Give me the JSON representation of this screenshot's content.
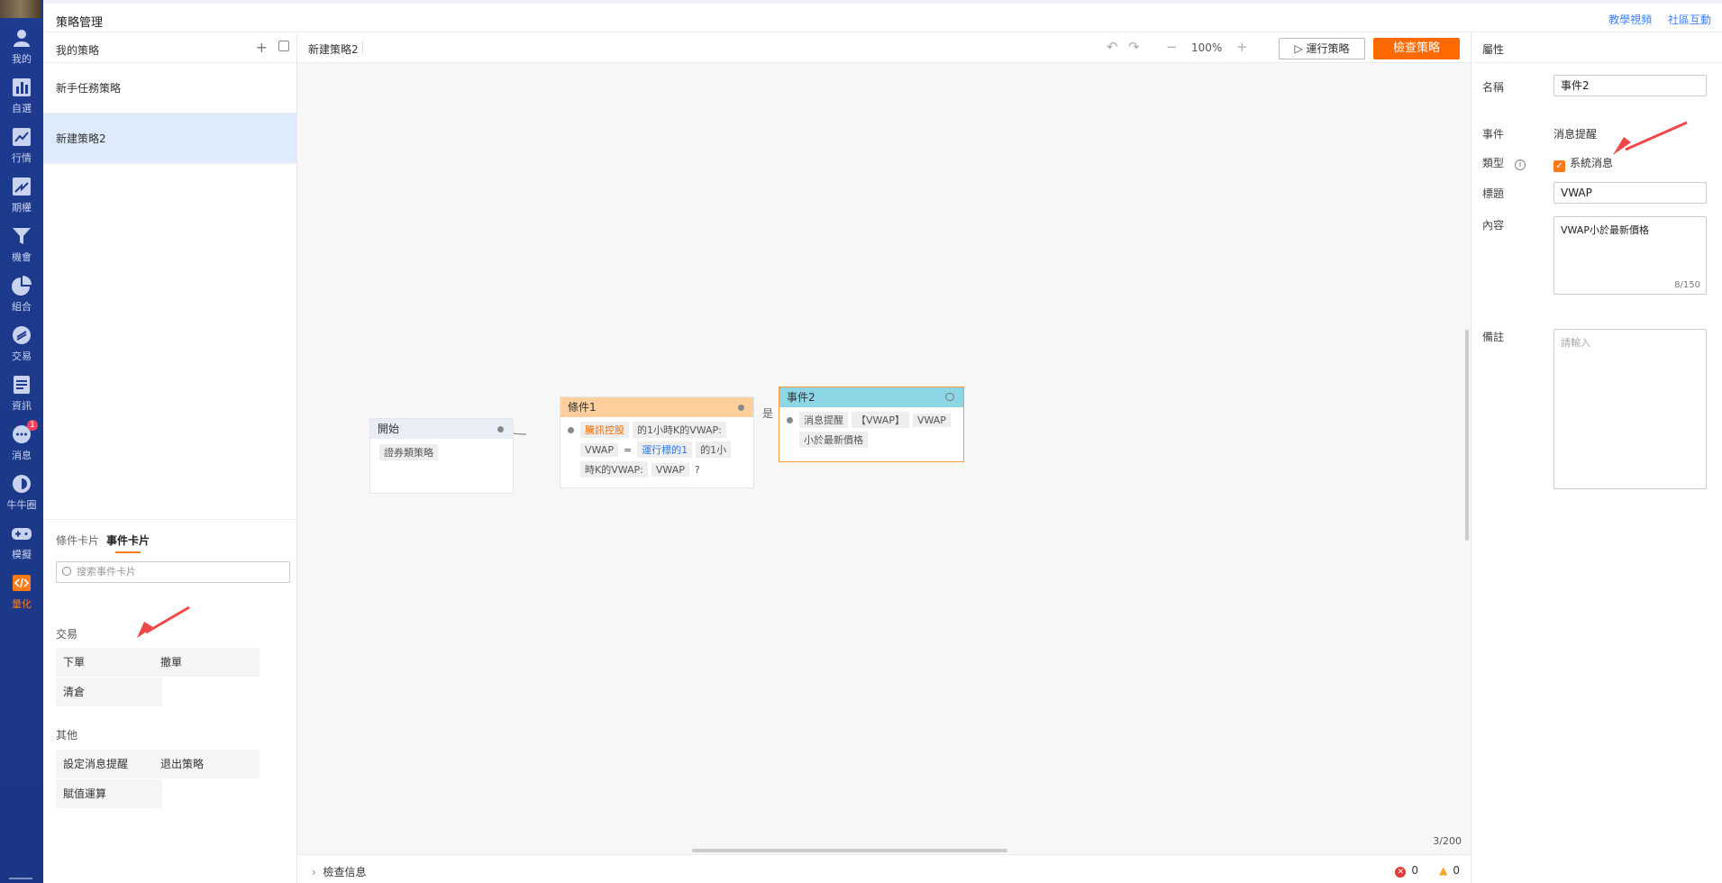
{
  "nav": [
    {
      "label": "我的",
      "icon": "user-icon"
    },
    {
      "label": "自選",
      "icon": "bar-chart-icon"
    },
    {
      "label": "行情",
      "icon": "trend-icon"
    },
    {
      "label": "期權",
      "icon": "options-icon"
    },
    {
      "label": "機會",
      "icon": "funnel-icon"
    },
    {
      "label": "組合",
      "icon": "pie-icon"
    },
    {
      "label": "交易",
      "icon": "exchange-icon"
    },
    {
      "label": "資訊",
      "icon": "news-icon"
    },
    {
      "label": "消息",
      "icon": "chat-icon",
      "badge": "1"
    },
    {
      "label": "牛牛圈",
      "icon": "circle-icon"
    },
    {
      "label": "模擬",
      "icon": "gamepad-icon"
    },
    {
      "label": "量化",
      "icon": "code-icon",
      "active": true
    }
  ],
  "topbar": {
    "title": "策略管理",
    "links": [
      "教學視頻",
      "社區互動"
    ]
  },
  "left": {
    "header": "我的策略",
    "strategies": [
      {
        "name": "新手任務策略"
      },
      {
        "name": "新建策略2",
        "selected": true
      }
    ],
    "tabs": [
      "條件卡片",
      "事件卡片"
    ],
    "search_placeholder": "搜索事件卡片",
    "groups": [
      {
        "title": "交易",
        "items": [
          "下單",
          "撤單",
          "清倉"
        ]
      },
      {
        "title": "其他",
        "items": [
          "設定消息提醒",
          "退出策略",
          "賦值運算"
        ]
      }
    ]
  },
  "toolbar": {
    "name": "新建策略2",
    "zoom": "100%",
    "run": "運行策略",
    "check": "檢查策略"
  },
  "canvas": {
    "start": {
      "title": "開始",
      "tag": "證券類策略"
    },
    "cond": {
      "title": "條件1",
      "t1": "騰訊控股",
      "t2": "的1小時K的VWAP:",
      "t3": "VWAP",
      "t4": "=",
      "t5": "運行標的1",
      "t6": "的1小",
      "t7": "時K的VWAP:",
      "t8": "VWAP",
      "t9": "?",
      "yes": "是"
    },
    "event": {
      "title": "事件2",
      "t1": "消息提醒",
      "t2": "【VWAP】",
      "t3": "VWAP",
      "t4": "小於最新價格"
    },
    "count": "3/200"
  },
  "status": {
    "label": "檢查信息",
    "errors": "0",
    "warnings": "0"
  },
  "props": {
    "header": "屬性",
    "name_label": "名稱",
    "name_value": "事件2",
    "event_label": "事件",
    "event_value": "消息提醒",
    "type_label": "類型",
    "type_value": "系統消息",
    "title_label": "標題",
    "title_value": "VWAP",
    "content_label": "內容",
    "content_value": "VWAP小於最新價格",
    "content_count": "8/150",
    "note_label": "備註",
    "note_placeholder": "請輸入"
  },
  "colors": {
    "accent": "#ff6a00",
    "nav_bg": "#1d3b8f",
    "selected": "#ddebfc",
    "event_head": "#8cd6e6",
    "cond_head": "#ffcf9e"
  }
}
